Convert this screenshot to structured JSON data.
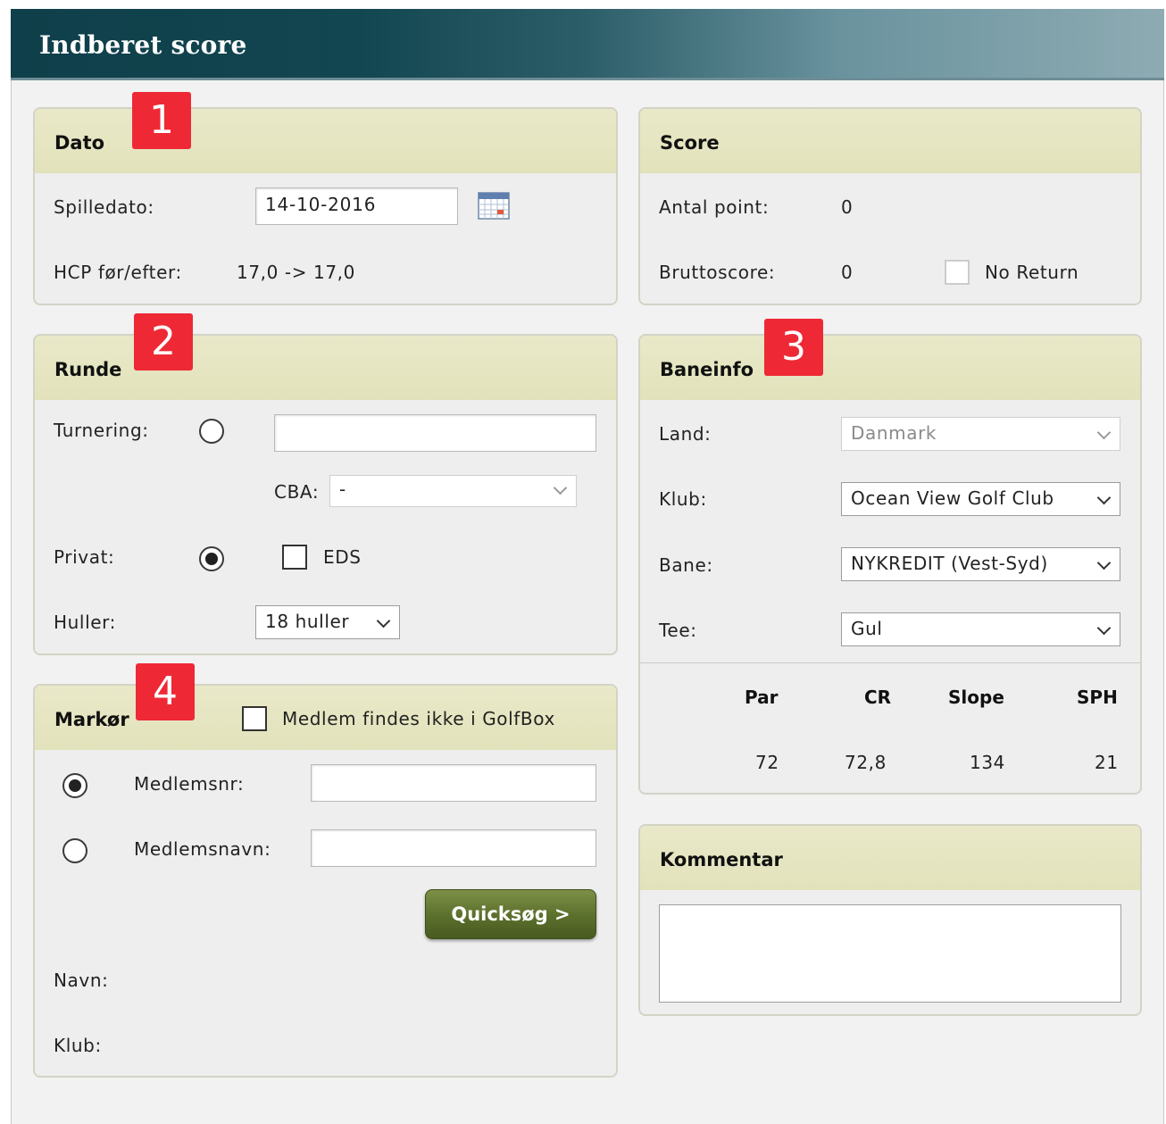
{
  "header": {
    "title": "Indberet score"
  },
  "dato": {
    "title": "Dato",
    "badge": "1",
    "spilledato_label": "Spilledato:",
    "spilledato_value": "14-10-2016",
    "hcp_label": "HCP før/efter:",
    "hcp_value": "17,0 -> 17,0"
  },
  "score": {
    "title": "Score",
    "antal_label": "Antal point:",
    "antal_value": "0",
    "brutto_label": "Bruttoscore:",
    "brutto_value": "0",
    "no_return_label": "No Return",
    "no_return_checked": false
  },
  "runde": {
    "title": "Runde",
    "badge": "2",
    "turnering_label": "Turnering:",
    "turnering_value": "",
    "cba_label": "CBA:",
    "cba_value": "-",
    "privat_label": "Privat:",
    "type_selected": "privat",
    "eds_label": "EDS",
    "eds_checked": false,
    "huller_label": "Huller:",
    "huller_value": "18 huller"
  },
  "baneinfo": {
    "title": "Baneinfo",
    "badge": "3",
    "land_label": "Land:",
    "land_value": "Danmark",
    "klub_label": "Klub:",
    "klub_value": "Ocean View Golf Club",
    "bane_label": "Bane:",
    "bane_value": "NYKREDIT (Vest-Syd)",
    "tee_label": "Tee:",
    "tee_value": "Gul",
    "stats": {
      "headers": [
        "Par",
        "CR",
        "Slope",
        "SPH"
      ],
      "values": [
        "72",
        "72,8",
        "134",
        "21"
      ]
    }
  },
  "markor": {
    "title": "Markør",
    "badge": "4",
    "not_member_label": "Medlem findes ikke i GolfBox",
    "not_member_checked": false,
    "medlemsnr_label": "Medlemsnr:",
    "medlemsnr_value": "",
    "medlemsnavn_label": "Medlemsnavn:",
    "medlemsnavn_value": "",
    "search_selected": "medlemsnr",
    "quicksearch_label": "Quicksøg >",
    "navn_label": "Navn:",
    "klub_label": "Klub:"
  },
  "kommentar": {
    "title": "Kommentar",
    "value": ""
  },
  "icons": {
    "calendar": "calendar-icon",
    "dropdown": "chevron-down-icon"
  },
  "colors": {
    "header_dark": "#0f3f4a",
    "panel_head": "#e4e4be",
    "badge": "#ee2935",
    "button": "#5b6f2c"
  }
}
